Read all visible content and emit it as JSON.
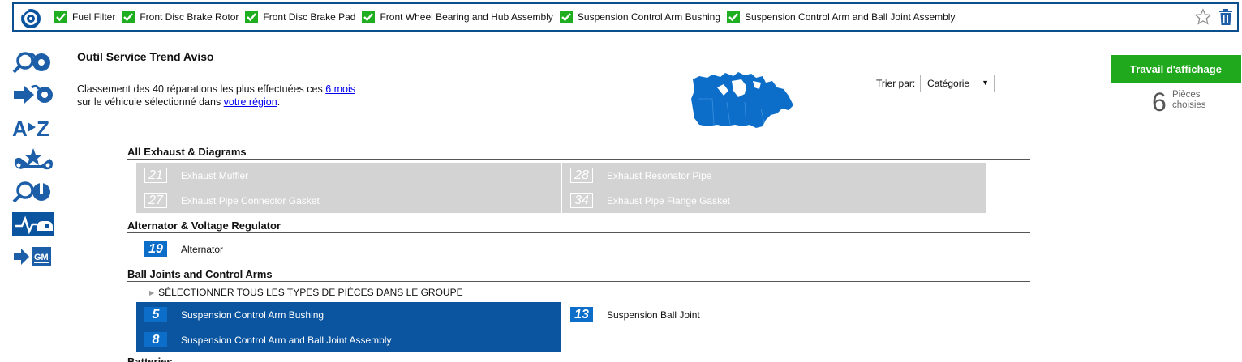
{
  "topbar": {
    "selected_parts": [
      "Fuel Filter",
      "Front Disc Brake Rotor",
      "Front Disc Brake Pad",
      "Front Wheel Bearing and Hub Assembly",
      "Suspension Control Arm Bushing",
      "Suspension Control Arm and Ball Joint Assembly"
    ]
  },
  "sidebar": {
    "icons": [
      "search-parts-icon",
      "arrow-search-icon",
      "a-to-z-icon",
      "star-wrench-icon",
      "wrench-search-icon",
      "trend-wave-icon",
      "gm-arrow-icon"
    ]
  },
  "header": {
    "title": "Outil Service Trend Aviso",
    "desc_line1_prefix": "Classement des 40 réparations les plus effectuées ces ",
    "desc_link1": "6 mois",
    "desc_line2_prefix": "sur le véhicule sélectionné dans ",
    "desc_link2": "votre région",
    "desc_line2_suffix": "."
  },
  "sort": {
    "label": "Trier par:",
    "value": "Catégorie"
  },
  "action": {
    "button_label": "Travail d'affichage",
    "count": "6",
    "count_label_1": "Pièces",
    "count_label_2": "choisies"
  },
  "groups": [
    {
      "title": "All Exhaust & Diagrams",
      "parts": [
        {
          "num": "21",
          "name": "Exhaust Muffler",
          "state": "disabled"
        },
        {
          "num": "28",
          "name": "Exhaust Resonator Pipe",
          "state": "disabled"
        },
        {
          "num": "27",
          "name": "Exhaust Pipe Connector Gasket",
          "state": "disabled"
        },
        {
          "num": "34",
          "name": "Exhaust Pipe Flange Gasket",
          "state": "disabled"
        }
      ]
    },
    {
      "title": "Alternator & Voltage Regulator",
      "parts": [
        {
          "num": "19",
          "name": "Alternator",
          "state": "normal"
        }
      ]
    },
    {
      "title": "Ball Joints and Control Arms",
      "select_all": "SÉLECTIONNER TOUS LES TYPES DE PIÈCES DANS LE GROUPE",
      "parts": [
        {
          "num": "5",
          "name": "Suspension Control Arm Bushing",
          "state": "selected"
        },
        {
          "num": "13",
          "name": "Suspension Ball Joint",
          "state": "normal"
        },
        {
          "num": "8",
          "name": "Suspension Control Arm and Ball Joint Assembly",
          "state": "selected"
        }
      ]
    },
    {
      "title": "Batteries"
    }
  ],
  "colors": {
    "brand_blue": "#0b55a0",
    "number_blue": "#0c6ec9",
    "check_green": "#1fae20",
    "button_green": "#21a91e",
    "disabled_gray": "#d3d3d3"
  }
}
